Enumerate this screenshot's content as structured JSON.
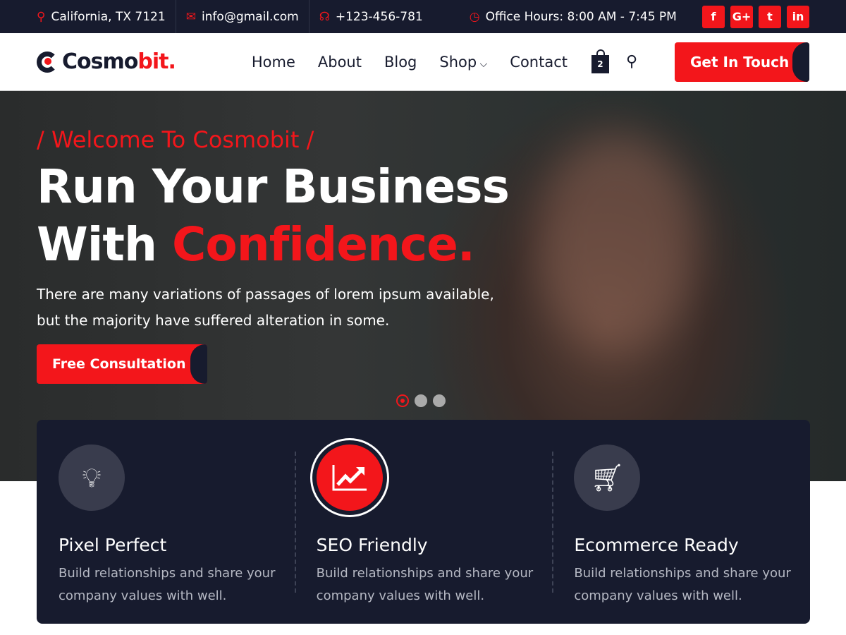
{
  "topbar": {
    "address": "California, TX 7121",
    "email": "info@gmail.com",
    "phone": "+123-456-781",
    "hours": "Office Hours: 8:00 AM - 7:45 PM",
    "socials": [
      "f",
      "G+",
      "t",
      "in"
    ]
  },
  "header": {
    "logo_main": "Cosmo",
    "logo_accent": "bit.",
    "nav": [
      "Home",
      "About",
      "Blog",
      "Shop",
      "Contact"
    ],
    "cart_count": "2",
    "cta": "Get In Touch"
  },
  "hero": {
    "pretitle": "/ Welcome To Cosmobit /",
    "title_line1": "Run Your Business",
    "title_line2_a": "With ",
    "title_line2_b": "Confidence.",
    "description": "There are many variations of passages of lorem ipsum available, but the majority have suffered alteration in some.",
    "button": "Free Consultation",
    "active_slide": 1,
    "slide_count": 3
  },
  "features": [
    {
      "icon": "lightbulb-icon",
      "title": "Pixel Perfect",
      "text": "Build relationships and share your company values with well."
    },
    {
      "icon": "chart-up-icon",
      "title": "SEO Friendly",
      "text": "Build relationships and share your company values with well."
    },
    {
      "icon": "cart-icon",
      "title": "Ecommerce Ready",
      "text": "Build relationships and share your company values with well."
    }
  ],
  "colors": {
    "accent": "#f3161b",
    "dark": "#171b2e"
  }
}
